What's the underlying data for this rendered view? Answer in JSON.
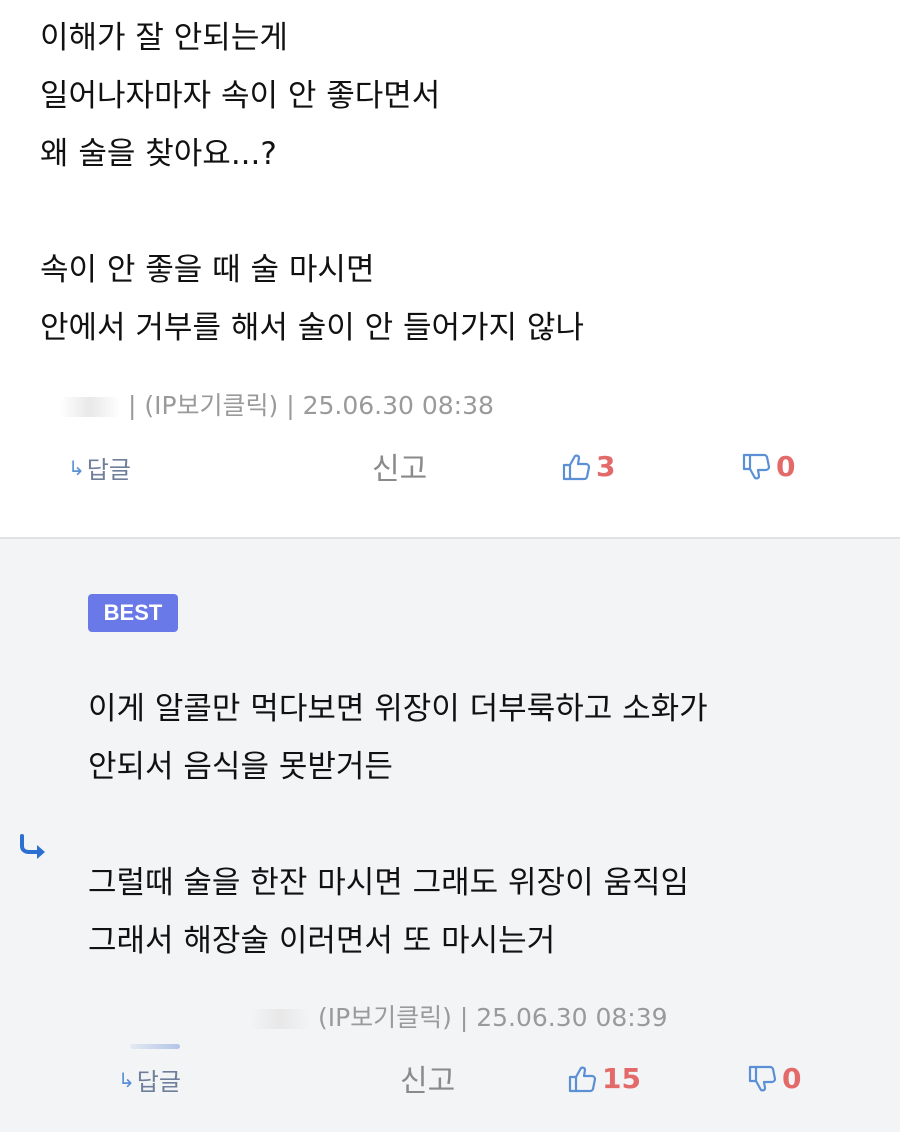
{
  "comments": [
    {
      "lines": [
        "이해가 잘 안되는게",
        "일어나자마자 속이 안 좋다면서",
        "왜 술을 찾아요...?",
        "",
        "속이 안 좋을 때 술 마시면",
        "안에서 거부를 해서 술이 안 들어가지 않나"
      ],
      "meta": "| (IP보기클릭) | 25.06.30 08:38",
      "reply_label": "답글",
      "report_label": "신고",
      "upvotes": "3",
      "downvotes": "0"
    },
    {
      "badge": "BEST",
      "lines": [
        "이게 알콜만 먹다보면 위장이 더부룩하고 소화가",
        "안되서 음식을 못받거든",
        "",
        "그럴때 술을 한잔 마시면 그래도 위장이 움직임",
        "그래서 해장술 이러면서 또 마시는거"
      ],
      "meta": "(IP보기클릭) | 25.06.30 08:39",
      "reply_label": "답글",
      "report_label": "신고",
      "upvotes": "15",
      "downvotes": "0"
    }
  ],
  "icons": {
    "reply_arrow": "reply-arrow-icon",
    "thumbs_up": "thumbs-up-icon",
    "thumbs_down": "thumbs-down-icon",
    "reply_indicator": "reply-indicator-icon"
  },
  "colors": {
    "badge": "#6a79e8",
    "vote_count": "#e46a6a",
    "thumb_icon": "#5b8fd6",
    "reply_bg": "#f3f4f6"
  }
}
